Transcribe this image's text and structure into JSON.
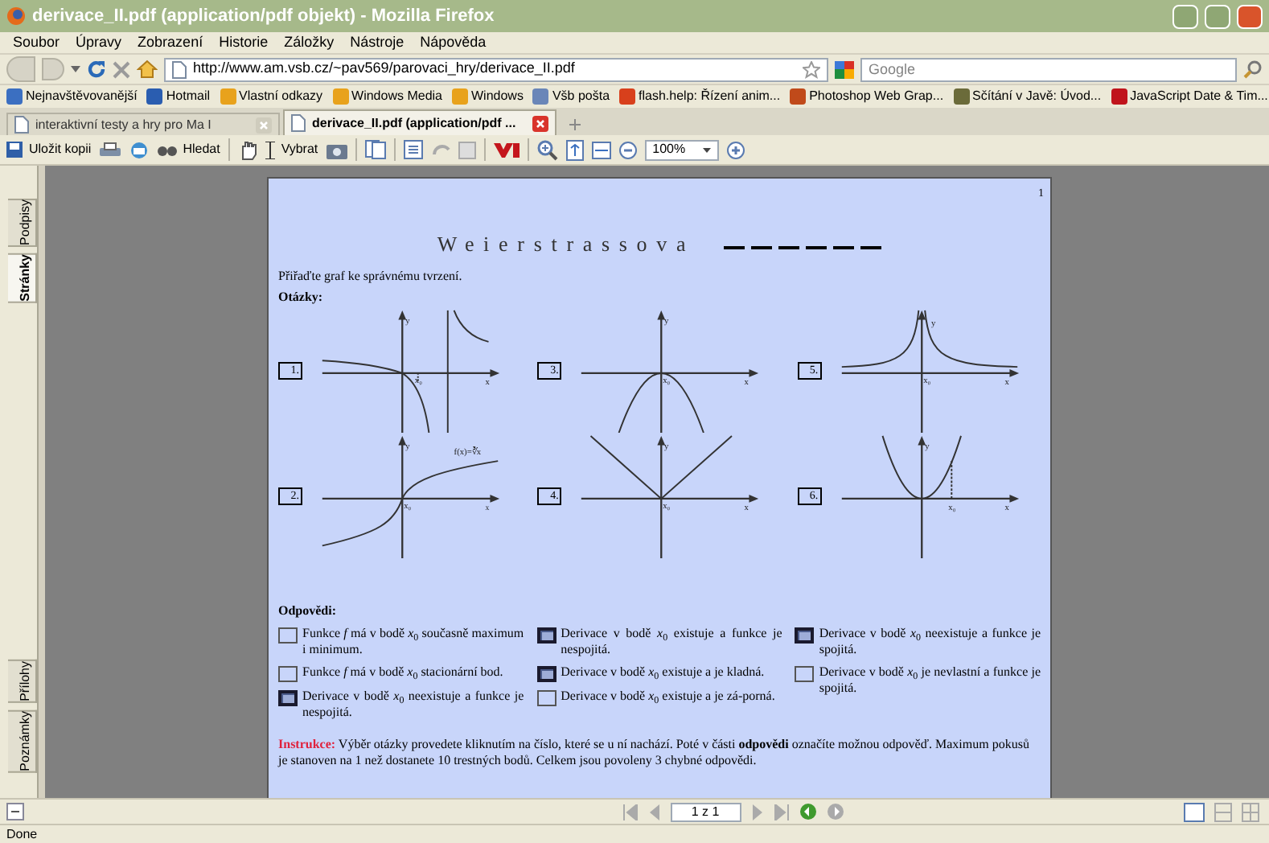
{
  "window": {
    "title": "derivace_II.pdf (application/pdf objekt) - Mozilla Firefox"
  },
  "menu": [
    "Soubor",
    "Úpravy",
    "Zobrazení",
    "Historie",
    "Záložky",
    "Nástroje",
    "Nápověda"
  ],
  "address": {
    "value": "http://www.am.vsb.cz/~pav569/parovaci_hry/derivace_II.pdf"
  },
  "search": {
    "placeholder": "Google"
  },
  "bookmarks": [
    "Nejnavštěvovanější",
    "Hotmail",
    "Vlastní odkazy",
    "Windows Media",
    "Windows",
    "Všb pošta",
    "flash.help: Řízení anim...",
    "Photoshop Web Grap...",
    "Sčítání v Javě: Úvod...",
    "JavaScript Date & Tim..."
  ],
  "tabs": [
    {
      "label": "interaktivní testy a hry pro Ma I",
      "selected": false
    },
    {
      "label": "derivace_II.pdf (application/pdf ...",
      "selected": true
    }
  ],
  "pdf_toolbar": {
    "save": "Uložit kopii",
    "find": "Hledat",
    "select": "Vybrat",
    "zoom": "100%"
  },
  "side_tabs": [
    {
      "label": "Podpisy",
      "selected": false
    },
    {
      "label": "Stránky",
      "selected": true
    },
    {
      "label": "Přílohy",
      "selected": false
    },
    {
      "label": "Poznámky",
      "selected": false
    }
  ],
  "page": {
    "number": "1",
    "title": "Weierstrassova",
    "prompt": "Přiřaďte graf ke správnému tvrzení.",
    "questions_heading": "Otázky:",
    "graphs": [
      {
        "number": "1.",
        "kind": "pole",
        "labels": [
          "y",
          "x₀",
          "x"
        ]
      },
      {
        "number": "3.",
        "kind": "cap",
        "labels": [
          "y",
          "x₀",
          "x"
        ]
      },
      {
        "number": "5.",
        "kind": "cusp",
        "labels": [
          "y",
          "x₀",
          "x"
        ]
      },
      {
        "number": "2.",
        "kind": "root",
        "labels": [
          "y",
          "f(x)=∛x",
          "x₀",
          "x"
        ]
      },
      {
        "number": "4.",
        "kind": "abs",
        "labels": [
          "y",
          "x₀",
          "x"
        ]
      },
      {
        "number": "6.",
        "kind": "cup",
        "labels": [
          "y",
          "x₀",
          "x"
        ]
      }
    ],
    "answers_heading": "Odpovědi:",
    "answers": [
      [
        {
          "text": "Funkce *f* má v bodě *x*$_{0}$ současně maximum i minimum.",
          "highlighted": false
        },
        {
          "text": "Funkce *f* má v bodě *x*$_{0}$ stacionární bod.",
          "highlighted": false
        },
        {
          "text": "Derivace v bodě *x*$_{0}$ neexistuje a funkce je nespojitá.",
          "highlighted": true
        }
      ],
      [
        {
          "text": "Derivace v bodě *x*$_{0}$ existuje a funkce je nespojitá.",
          "highlighted": true
        },
        {
          "text": "Derivace v bodě *x*$_{0}$ existuje a je kladná.",
          "highlighted": true
        },
        {
          "text": "Derivace v bodě *x*$_{0}$ existuje a je zá-porná.",
          "highlighted": false
        }
      ],
      [
        {
          "text": "Derivace v bodě *x*$_{0}$ neexistuje a funkce je spojitá.",
          "highlighted": true
        },
        {
          "text": "Derivace v bodě *x*$_{0}$ je nevlastní a funkce je spojitá.",
          "highlighted": false
        }
      ]
    ],
    "instructions_label": "Instrukce:",
    "instructions": "Výběr otázky provedete kliknutím na číslo, které se u ní nachází. Poté v části **odpovědi** označíte možnou odpověď. Maximum pokusů je stanoven na 1 než dostanete 10 trestných bodů. Celkem jsou povoleny 3 chybné odpovědi."
  },
  "page_nav": {
    "value": "1 z 1"
  },
  "status_bar": "Done"
}
